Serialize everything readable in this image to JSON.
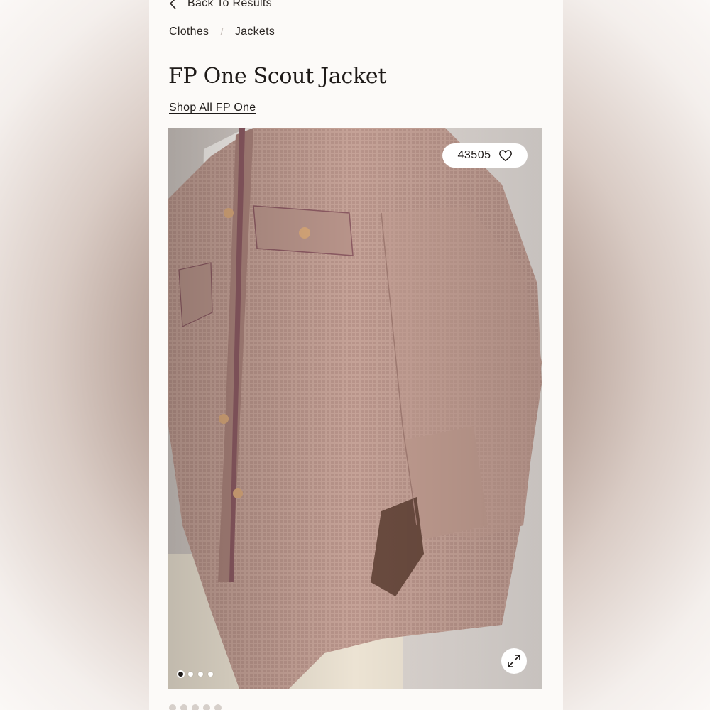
{
  "nav": {
    "back_label": "Back To Results",
    "breadcrumb": [
      "Clothes",
      "Jackets"
    ]
  },
  "product": {
    "title": "FP One Scout Jacket",
    "shop_link": "Shop All FP One",
    "favorites_count": "43505"
  },
  "gallery": {
    "image_count": 4,
    "active_index": 0
  },
  "icons": {
    "back": "chevron-left-icon",
    "favorite": "heart-outline-icon",
    "expand": "expand-arrows-icon"
  },
  "colors": {
    "background": "#fcfaf8",
    "text": "#1e1a18",
    "jacket": "#c5a297"
  }
}
